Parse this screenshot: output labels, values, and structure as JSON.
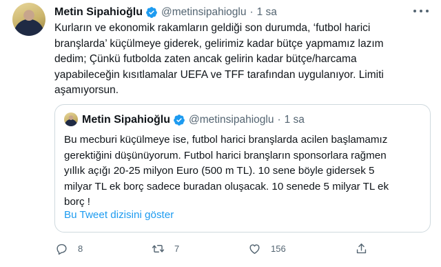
{
  "tweet": {
    "author_name": "Metin Sipahioğlu",
    "handle": "@metinsipahioglu",
    "separator": "·",
    "time": "1 sa",
    "text_lines": [
      "Kurların ve ekonomik rakamların geldiği son durumda, ‘futbol harici",
      "branşlarda’ küçülmeye giderek, gelirimiz kadar bütçe yapmamız lazım",
      "dedim; Çünkü futbolda zaten ancak gelirin kadar bütçe/harcama",
      "yapabileceğin kısıtlamalar UEFA ve TFF tarafından uygulanıyor. Limiti",
      "aşamıyorsun."
    ]
  },
  "quote": {
    "author_name": "Metin Sipahioğlu",
    "handle": "@metinsipahioglu",
    "separator": "·",
    "time": "1 sa",
    "text_lines": [
      "Bu mecburi küçülmeye ise, futbol harici branşlarda acilen başlamamız",
      "gerektiğini düşünüyorum. Futbol harici branşların sponsorlara rağmen",
      "yıllık açığı 20-25 milyon Euro (500 m TL). 10 sene böyle gidersek 5",
      "milyar TL ek borç sadece buradan oluşacak. 10 senede 5 milyar TL ek",
      "borç !"
    ],
    "thread_link": "Bu Tweet dizisini göster"
  },
  "actions": {
    "reply_icon": "reply-icon",
    "reply_count": "8",
    "retweet_icon": "retweet-icon",
    "retweet_count": "7",
    "like_icon": "heart-icon",
    "like_count": "156",
    "share_icon": "share-icon"
  },
  "colors": {
    "verified": "#1d9bf0",
    "link": "#1d9bf0",
    "secondary_text": "#536471",
    "border": "#cfd9de"
  }
}
